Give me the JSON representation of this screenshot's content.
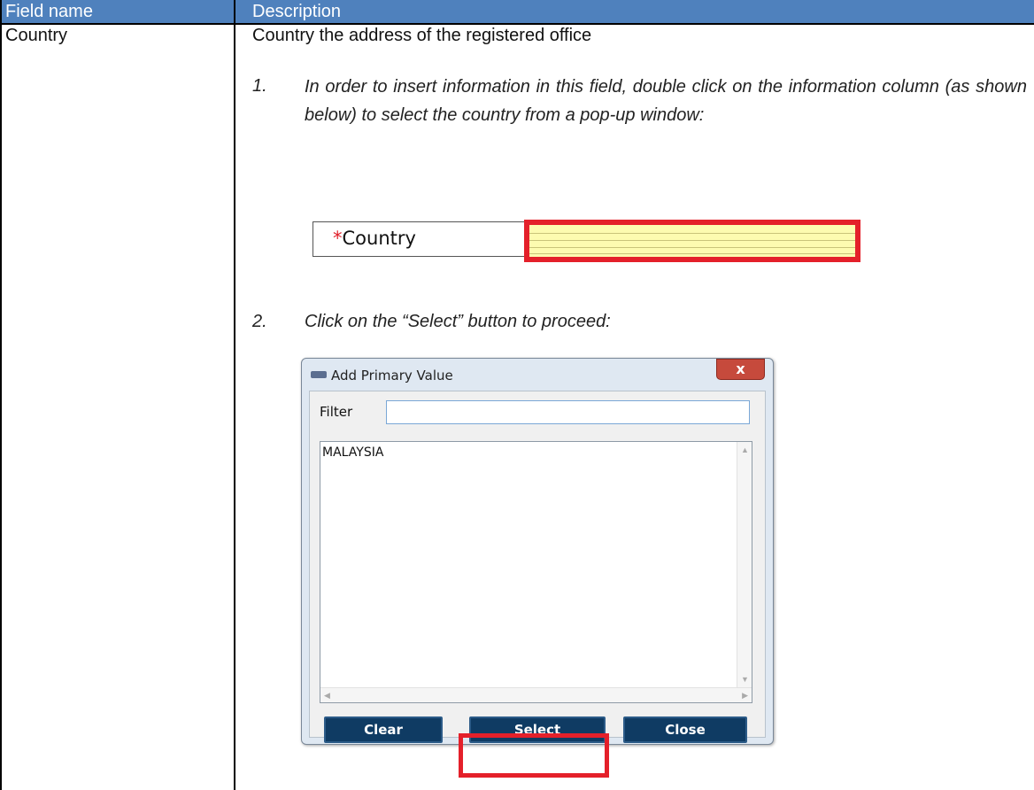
{
  "table": {
    "headers": [
      "Field name",
      "Description"
    ],
    "field_name": "Country",
    "description": "Country the address of the registered office",
    "steps": [
      {
        "num": "1.",
        "text": "In order to insert information in this field, double click on the information column (as shown below) to select the country from a pop-up window:"
      },
      {
        "num": "2.",
        "text": "Click on the “Select” button to proceed:"
      }
    ]
  },
  "country_field": {
    "required_mark": "*",
    "label": "Country"
  },
  "dialog": {
    "title": "Add Primary Value",
    "close_glyph": "x",
    "filter_label": "Filter",
    "filter_value": "",
    "list_items": [
      "MALAYSIA"
    ],
    "buttons": {
      "clear": "Clear",
      "select": "Select",
      "close": "Close"
    }
  },
  "colors": {
    "header_bg": "#4f81bd",
    "highlight": "#e4202a",
    "input_fill": "#fdfbb0",
    "button_bg": "#0f3b63"
  }
}
